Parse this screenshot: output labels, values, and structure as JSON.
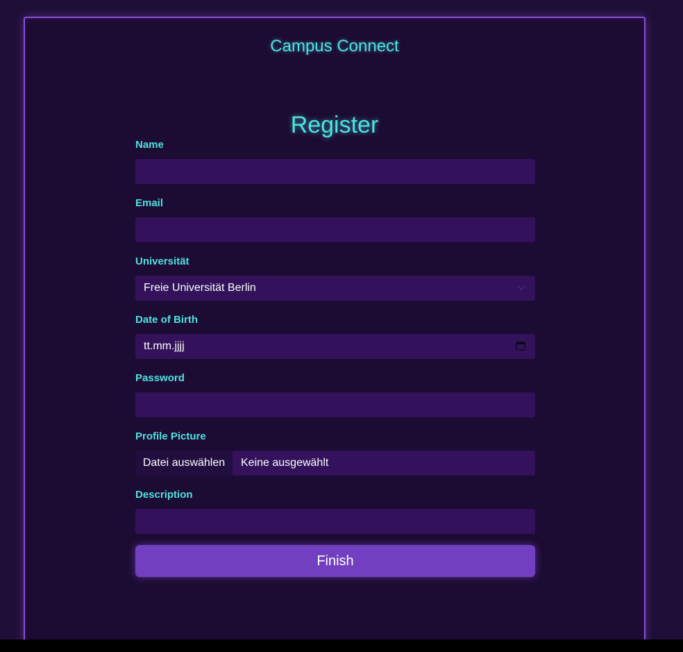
{
  "app": {
    "brand": "Campus Connect"
  },
  "form": {
    "title": "Register",
    "fields": {
      "name": {
        "label": "Name",
        "value": ""
      },
      "email": {
        "label": "Email",
        "value": ""
      },
      "university": {
        "label": "Universität",
        "selected": "Freie Universität Berlin"
      },
      "dob": {
        "label": "Date of Birth",
        "placeholder": "tt.mm.jjjj"
      },
      "password": {
        "label": "Password",
        "value": ""
      },
      "profile_picture": {
        "label": "Profile Picture",
        "button_label": "Datei auswählen",
        "status": "Keine ausgewählt"
      },
      "description": {
        "label": "Description",
        "value": ""
      }
    },
    "submit_label": "Finish"
  },
  "icons": {
    "select": "chevron-down-icon",
    "date": "calendar-icon"
  },
  "colors": {
    "accent": "#4ee3e0",
    "border": "#8a4fd8",
    "input_bg": "#33125b",
    "button": "#713fbf"
  }
}
